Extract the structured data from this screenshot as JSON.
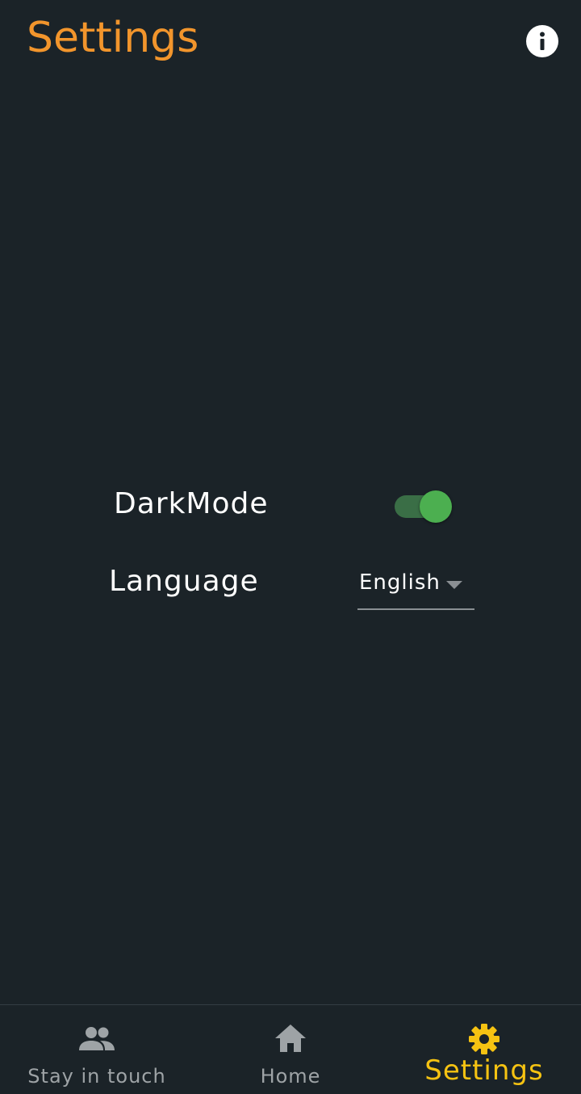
{
  "header": {
    "title": "Settings",
    "info_icon": "info-icon"
  },
  "settings": {
    "dark_mode_label": "DarkMode",
    "dark_mode_enabled": true,
    "language_label": "Language",
    "language_value": "English"
  },
  "bottom_nav": {
    "items": [
      {
        "label": "Stay in touch",
        "icon": "people-icon",
        "active": false
      },
      {
        "label": "Home",
        "icon": "home-icon",
        "active": false
      },
      {
        "label": "Settings",
        "icon": "gear-icon",
        "active": true
      }
    ]
  },
  "colors": {
    "background": "#1b2328",
    "title_orange": "#f2952c",
    "active_nav": "#f6c312",
    "inactive_nav": "#9ea3a6",
    "toggle_thumb": "#4caf50",
    "toggle_track": "#3a6e46"
  }
}
